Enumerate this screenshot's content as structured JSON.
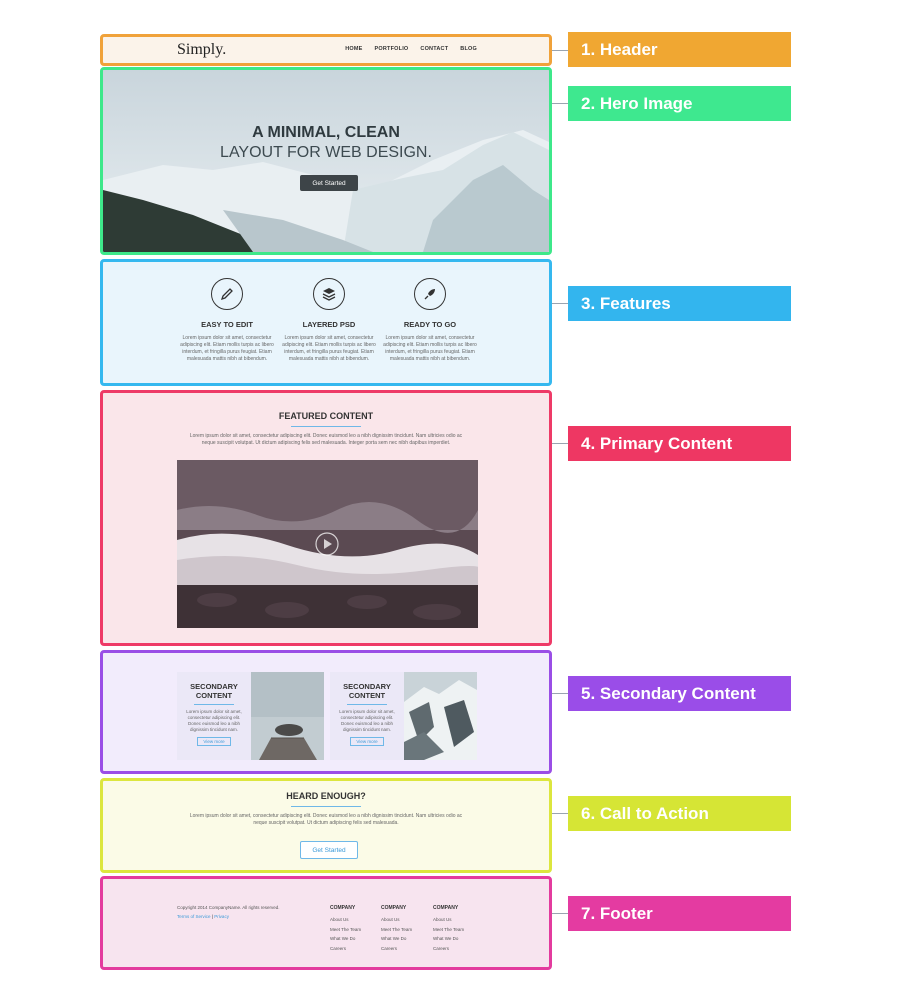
{
  "labels": [
    {
      "text": "1. Header",
      "color": "#f0a732"
    },
    {
      "text": "2. Hero Image",
      "color": "#3ee88f"
    },
    {
      "text": "3. Features",
      "color": "#33b5ee"
    },
    {
      "text": "4. Primary Content",
      "color": "#ee3763"
    },
    {
      "text": "5. Secondary Content",
      "color": "#9a4de8"
    },
    {
      "text": "6. Call to Action",
      "color": "#d6e535"
    },
    {
      "text": "7. Footer",
      "color": "#e43ba1"
    }
  ],
  "header": {
    "logo": "Simply.",
    "nav": [
      "HOME",
      "PORTFOLIO",
      "CONTACT",
      "BLOG"
    ]
  },
  "hero": {
    "title": "A MINIMAL, CLEAN",
    "subtitle": "LAYOUT FOR WEB DESIGN.",
    "button": "Get Started"
  },
  "features": {
    "items": [
      {
        "icon": "pencil-icon",
        "title": "EASY TO EDIT",
        "text": "Lorem ipsum dolor sit amet, consectetur adipiscing elit. Etiam mollis turpis ac libero interdum, et fringilla purus feugiat. Etiam malesuada mattis nibh at bibendum."
      },
      {
        "icon": "layers-icon",
        "title": "LAYERED PSD",
        "text": "Lorem ipsum dolor sit amet, consectetur adipiscing elit. Etiam mollis turpis ac libero interdum, et fringilla purus feugiat. Etiam malesuada mattis nibh at bibendum."
      },
      {
        "icon": "rocket-icon",
        "title": "READY TO GO",
        "text": "Lorem ipsum dolor sit amet, consectetur adipiscing elit. Etiam mollis turpis ac libero interdum, et fringilla purus feugiat. Etiam malesuada mattis nibh at bibendum."
      }
    ]
  },
  "primary": {
    "title": "FEATURED CONTENT",
    "text": "Lorem ipsum dolor sit amet, consectetur adipiscing elit. Donec euismod leo a nibh dignissim tincidunt. Nam ultricies odio ac neque suscipit volutpat. Ut dictum adipiscing felis sed malesuada. Integer porta sem nec nibh dapibus imperdiet."
  },
  "secondary": {
    "cards": [
      {
        "title": "SECONDARY CONTENT",
        "text": "Lorem ipsum dolor sit amet, consectetur adipiscing elit. Donec euismod leo a nibh dignissim tincidunt nam.",
        "button": "View more"
      },
      {
        "title": "SECONDARY CONTENT",
        "text": "Lorem ipsum dolor sit amet, consectetur adipiscing elit. Donec euismod leo a nibh dignissim tincidunt nam.",
        "button": "View more"
      }
    ]
  },
  "cta": {
    "title": "HEARD ENOUGH?",
    "text": "Lorem ipsum dolor sit amet, consectetur adipiscing elit. Donec euismod leo a nibh dignissim tincidunt. Nam ultricies odio ac neque suscipit volutpat. Ut dictum adipiscing felis sed malesuada.",
    "button": "Get Started"
  },
  "footer": {
    "copyright": "Copyright 2014 CompanyName. All rights reserved.",
    "terms": "Terms of Service",
    "separator": " | ",
    "privacy": "Privacy",
    "columns": [
      {
        "title": "COMPANY",
        "items": [
          "About Us",
          "Meet The Team",
          "What We Do",
          "Careers"
        ]
      },
      {
        "title": "COMPANY",
        "items": [
          "About Us",
          "Meet The Team",
          "What We Do",
          "Careers"
        ]
      },
      {
        "title": "COMPANY",
        "items": [
          "About Us",
          "Meet The Team",
          "What We Do",
          "Careers"
        ]
      }
    ]
  }
}
